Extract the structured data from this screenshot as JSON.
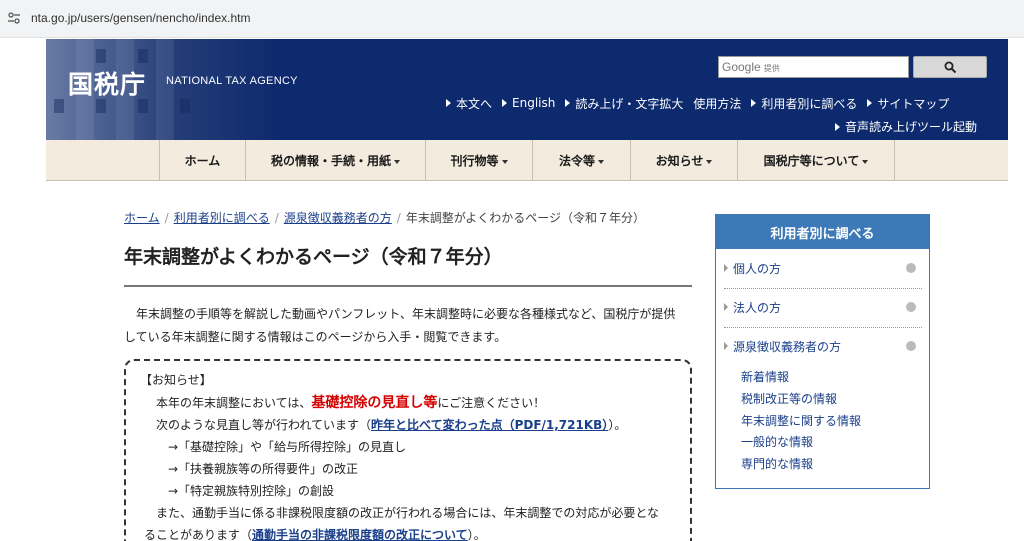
{
  "browser": {
    "url": "nta.go.jp/users/gensen/nencho/index.htm"
  },
  "header": {
    "logo_kanji": "国税庁",
    "logo_en": "NATIONAL TAX AGENCY",
    "search_brand": "Google",
    "search_brand_sub": "提供",
    "util_links": [
      "本文へ",
      "English",
      "読み上げ・文字拡大",
      "使用方法",
      "利用者別に調べる",
      "サイトマップ"
    ],
    "util_link_row2": "音声読み上げツール起動"
  },
  "nav": {
    "items": [
      {
        "label": "ホーム",
        "has_menu": false
      },
      {
        "label": "税の情報・手続・用紙",
        "has_menu": true
      },
      {
        "label": "刊行物等",
        "has_menu": true
      },
      {
        "label": "法令等",
        "has_menu": true
      },
      {
        "label": "お知らせ",
        "has_menu": true
      },
      {
        "label": "国税庁等について",
        "has_menu": true
      }
    ]
  },
  "breadcrumb": {
    "items": [
      "ホーム",
      "利用者別に調べる",
      "源泉徴収義務者の方"
    ],
    "current": "年末調整がよくわかるページ（令和７年分）"
  },
  "main": {
    "title": "年末調整がよくわかるページ（令和７年分）",
    "intro_line1": "年末調整の手順等を解説した動画やパンフレット、年末調整時に必要な各種様式など、国税庁が提供",
    "intro_line2": "している年末調整に関する情報はこのページから入手・閲覧できます。",
    "notice": {
      "head": "【お知らせ】",
      "l1_pre": "本年の年末調整においては、",
      "l1_red": "基礎控除の見直し等",
      "l1_post": "にご注意ください！",
      "l2_pre": "次のような見直し等が行われています（",
      "l2_link": "昨年と比べて変わった点（PDF/1,721KB）",
      "l2_post": "）。",
      "b1": "→「基礎控除」や「給与所得控除」の見直し",
      "b2": "→「扶養親族等の所得要件」の改正",
      "b3": "→「特定親族特別控除」の創設",
      "l6": "また、通勤手当に係る非課税限度額の改正が行われる場合には、年末調整での対応が必要とな",
      "l7_pre": "ることがあります（",
      "l7_link": "通勤手当の非課税限度額の改正について",
      "l7_post": "）。"
    }
  },
  "sidebar": {
    "title": "利用者別に調べる",
    "items": [
      "個人の方",
      "法人の方",
      "源泉徴収義務者の方"
    ],
    "sub_links": [
      "新着情報",
      "税制改正等の情報",
      "年末調整に関する情報",
      "一般的な情報",
      "専門的な情報"
    ]
  },
  "colors": {
    "header_bg": "#0e2a6e",
    "nav_bg": "#f3ecde",
    "sidebar_accent": "#3d79b6",
    "notice_red": "#d40000",
    "link": "#1a3f8a"
  }
}
